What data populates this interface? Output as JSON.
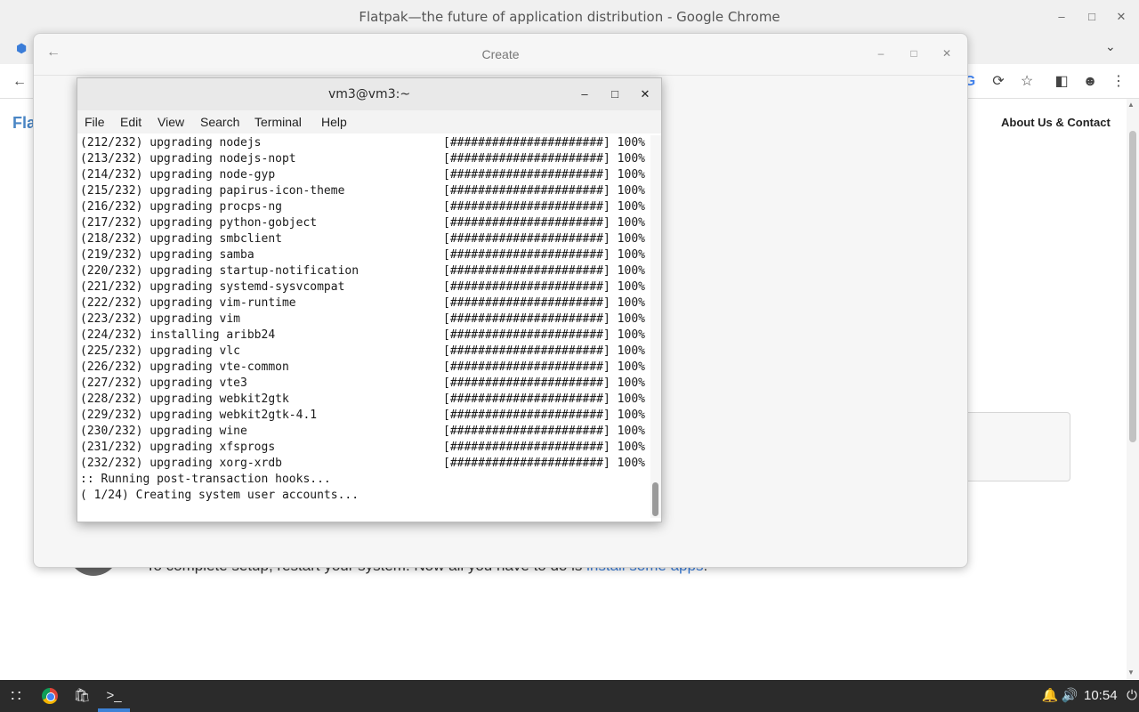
{
  "browser": {
    "window_title": "Flatpak—the future of application distribution - Google Chrome",
    "minimize_icon": "minimize-icon",
    "maximize_icon": "maximize-icon",
    "close_icon": "close-icon",
    "tab_favicon": "flatpak-favicon-icon",
    "tab_list": "chevron-down-icon",
    "toolbar_icons": [
      "back-arrow-icon",
      "google-icon",
      "share-icon",
      "star-icon",
      "sidebar-icon",
      "profile-icon",
      "kebab-menu-icon"
    ]
  },
  "webpage": {
    "brand_fragment": "Fla",
    "nav_about": "About Us & Contact",
    "setup_text": "To complete setup, restart your system. Now all you have to do is",
    "setup_link": "install some apps",
    "setup_end": "!"
  },
  "dialog": {
    "title": "Create",
    "back_icon": "back-arrow-icon"
  },
  "terminal": {
    "title": "vm3@vm3:~",
    "menu": [
      "File",
      "Edit",
      "View",
      "Search",
      "Terminal",
      "Help"
    ],
    "progress_bar": "[######################]",
    "lines": [
      {
        "text": "(212/232) upgrading nodejs",
        "pct": "100%"
      },
      {
        "text": "(213/232) upgrading nodejs-nopt",
        "pct": "100%"
      },
      {
        "text": "(214/232) upgrading node-gyp",
        "pct": "100%"
      },
      {
        "text": "(215/232) upgrading papirus-icon-theme",
        "pct": "100%"
      },
      {
        "text": "(216/232) upgrading procps-ng",
        "pct": "100%"
      },
      {
        "text": "(217/232) upgrading python-gobject",
        "pct": "100%"
      },
      {
        "text": "(218/232) upgrading smbclient",
        "pct": "100%"
      },
      {
        "text": "(219/232) upgrading samba",
        "pct": "100%"
      },
      {
        "text": "(220/232) upgrading startup-notification",
        "pct": "100%"
      },
      {
        "text": "(221/232) upgrading systemd-sysvcompat",
        "pct": "100%"
      },
      {
        "text": "(222/232) upgrading vim-runtime",
        "pct": "100%"
      },
      {
        "text": "(223/232) upgrading vim",
        "pct": "100%"
      },
      {
        "text": "(224/232) installing aribb24",
        "pct": "100%"
      },
      {
        "text": "(225/232) upgrading vlc",
        "pct": "100%"
      },
      {
        "text": "(226/232) upgrading vte-common",
        "pct": "100%"
      },
      {
        "text": "(227/232) upgrading vte3",
        "pct": "100%"
      },
      {
        "text": "(228/232) upgrading webkit2gtk",
        "pct": "100%"
      },
      {
        "text": "(229/232) upgrading webkit2gtk-4.1",
        "pct": "100%"
      },
      {
        "text": "(230/232) upgrading wine",
        "pct": "100%"
      },
      {
        "text": "(231/232) upgrading xfsprogs",
        "pct": "100%"
      },
      {
        "text": "(232/232) upgrading xorg-xrdb",
        "pct": "100%"
      }
    ],
    "hooks_line": ":: Running post-transaction hooks...",
    "step_line": "( 1/24) Creating system user accounts..."
  },
  "taskbar": {
    "apps": [
      "app-grid-icon",
      "chrome-icon",
      "software-store-icon",
      "terminal-icon"
    ],
    "tray": [
      "bell-icon",
      "volume-icon",
      "power-icon"
    ],
    "clock": "10:54"
  }
}
